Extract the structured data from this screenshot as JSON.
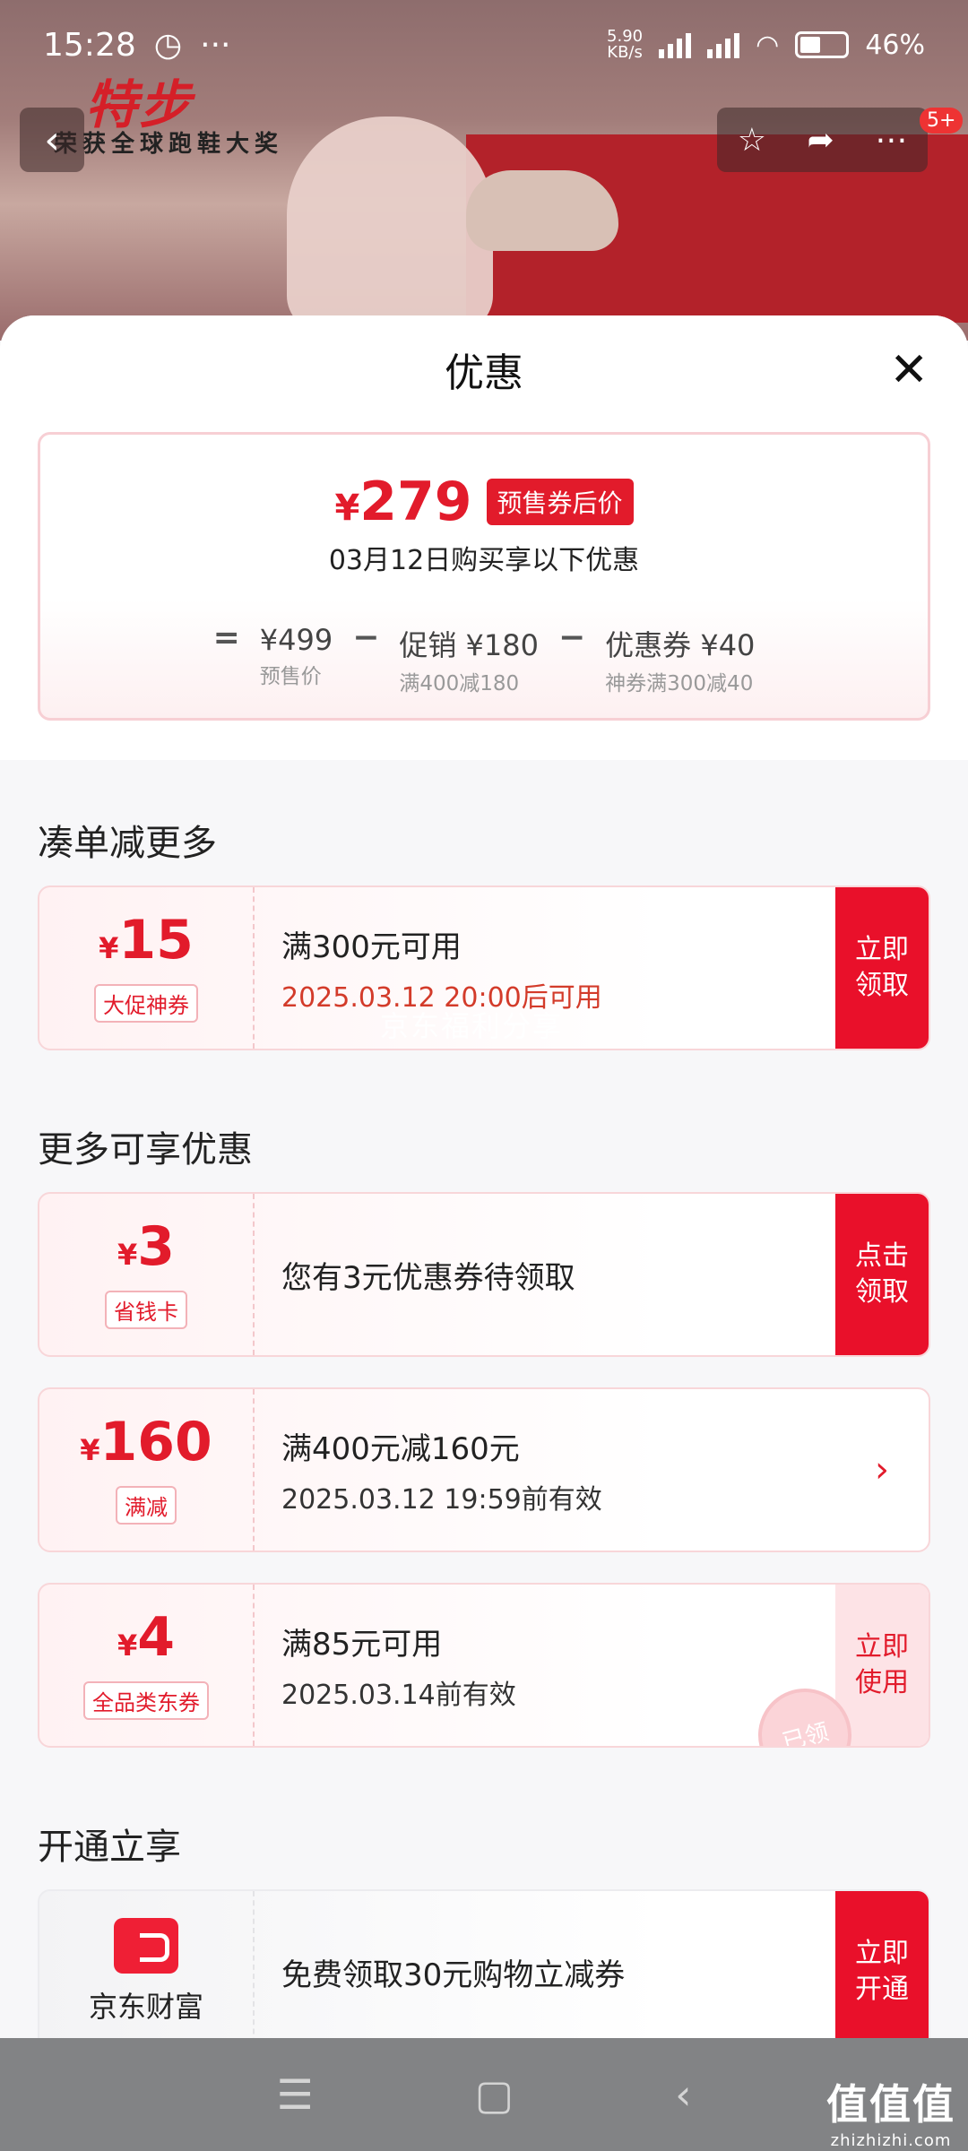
{
  "status_bar": {
    "time": "15:28",
    "rate_top": "5.90",
    "rate_bottom": "KB/s",
    "battery": "46%"
  },
  "background": {
    "brand": "特步",
    "slogan": "荣获全球跑鞋大奖",
    "badge": "5+"
  },
  "sheet": {
    "title": "优惠",
    "close": "✕"
  },
  "price_card": {
    "final_yen": "¥",
    "final_price": "279",
    "final_tag": "预售券后价",
    "subtitle": "03月12日购买享以下优惠",
    "formula": [
      {
        "op": "="
      },
      {
        "value": "¥499",
        "label": "预售价"
      },
      {
        "op": "−"
      },
      {
        "value": "促销 ¥180",
        "label": "满400减180"
      },
      {
        "op": "−"
      },
      {
        "value": "优惠券 ¥40",
        "label": "神券满300减40"
      }
    ]
  },
  "sections": {
    "more_combine": "凑单减更多",
    "more_offers": "更多可享优惠",
    "open_enjoy": "开通立享"
  },
  "coupons": {
    "c15": {
      "yen": "¥",
      "amount": "15",
      "tag": "大促神券",
      "title": "满300元可用",
      "detail": "2025.03.12 20:00后可用",
      "button": "立即领取",
      "watermark": "京东福利分享"
    },
    "c3": {
      "yen": "¥",
      "amount": "3",
      "tag": "省钱卡",
      "title": "您有3元优惠券待领取",
      "button": "点击领取"
    },
    "c160": {
      "yen": "¥",
      "amount": "160",
      "tag": "满减",
      "title": "满400元减160元",
      "detail": "2025.03.12 19:59前有效",
      "arrow": "›"
    },
    "c4": {
      "yen": "¥",
      "amount": "4",
      "tag": "全品类东券",
      "title": "满85元可用",
      "detail": "2025.03.14前有效",
      "button": "立即使用",
      "stamp": "已领"
    },
    "wallet": {
      "name": "京东财富",
      "title": "免费领取30元购物立减券",
      "button": "立即开通"
    }
  },
  "nav": {
    "menu": "☰",
    "home": "▢",
    "back": "‹"
  },
  "site_mark": {
    "logo": "值值值",
    "url": "zhizhizhi.com"
  }
}
